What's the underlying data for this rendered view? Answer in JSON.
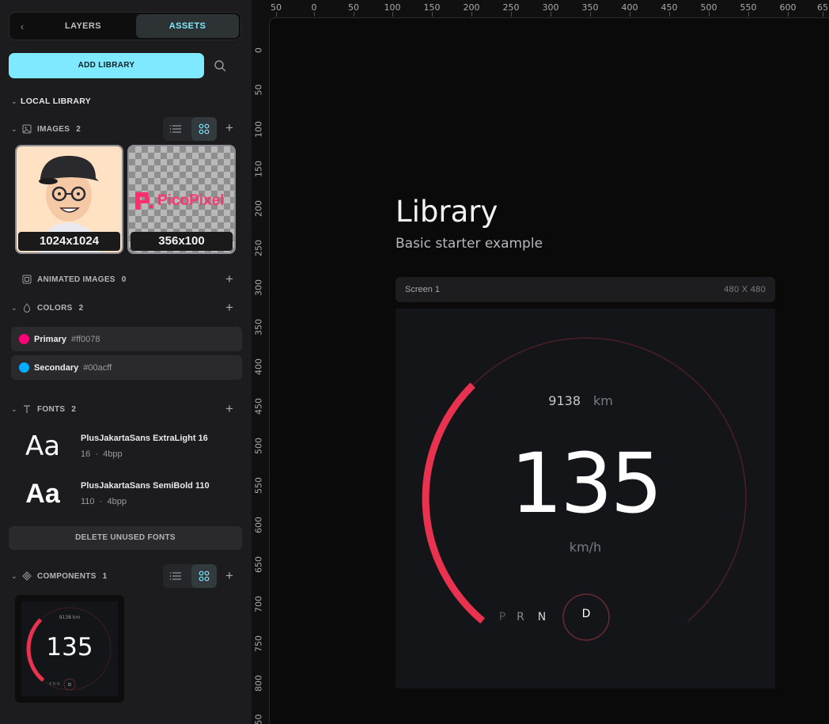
{
  "sidebar": {
    "tabs": {
      "layers": "LAYERS",
      "assets": "ASSETS"
    },
    "add_library": "ADD LIBRARY",
    "local_library": "LOCAL LIBRARY",
    "images": {
      "label": "IMAGES",
      "count": "2",
      "items": [
        {
          "label": "1024x1024"
        },
        {
          "label": "356x100",
          "logo_text": "PicoPixel"
        }
      ]
    },
    "animated_images": {
      "label": "ANIMATED IMAGES",
      "count": "0"
    },
    "colors": {
      "label": "COLORS",
      "count": "2",
      "items": [
        {
          "name": "Primary",
          "hex": "#ff0078"
        },
        {
          "name": "Secondary",
          "hex": "#00acff"
        }
      ]
    },
    "fonts": {
      "label": "FONTS",
      "count": "2",
      "items": [
        {
          "sample": "Aa",
          "name": "PlusJakartaSans ExtraLight 16",
          "size": "16",
          "sep": "·",
          "bpp": "4bpp"
        },
        {
          "sample": "Aa",
          "name": "PlusJakartaSans SemiBold 110",
          "size": "110",
          "sep": "·",
          "bpp": "4bpp"
        }
      ],
      "delete_unused": "DELETE UNUSED FONTS"
    },
    "components": {
      "label": "COMPONENTS",
      "count": "1",
      "thumb": {
        "speed": "135",
        "odometer": "9138 km",
        "gears": "P R N",
        "gear_active": "D"
      }
    }
  },
  "rulers": {
    "top": [
      "50",
      "0",
      "50",
      "100",
      "150",
      "200",
      "250",
      "300",
      "350",
      "400",
      "450",
      "500",
      "550",
      "600",
      "65"
    ],
    "left": [
      "0",
      "50",
      "100",
      "150",
      "200",
      "250",
      "300",
      "350",
      "400",
      "450",
      "500",
      "550",
      "600",
      "650",
      "700",
      "750",
      "800",
      "50"
    ]
  },
  "library": {
    "title": "Library",
    "subtitle": "Basic starter example"
  },
  "screen": {
    "name": "Screen 1",
    "dimensions": "480 X 480",
    "odometer_value": "9138",
    "odometer_unit": "km",
    "speed": "135",
    "speed_unit": "km/h",
    "gears": [
      "P",
      "R",
      "N"
    ],
    "gear_active": "D",
    "speed_fraction": 0.34
  },
  "colors": {
    "accent": "#7fe9ff",
    "primary": "#ff0078",
    "secondary": "#00acff",
    "gauge": "#e8324f"
  }
}
